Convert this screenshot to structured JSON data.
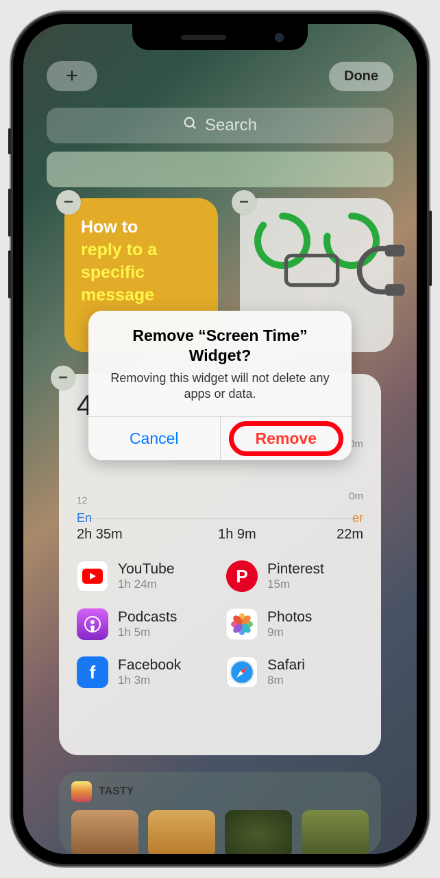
{
  "topbar": {
    "add": "+",
    "done": "Done"
  },
  "search": {
    "placeholder": "Search"
  },
  "widgets": {
    "notes": {
      "prefix": "How to",
      "highlight": "reply to a specific message"
    },
    "batteries": {
      "items": [
        {
          "icon": "phone",
          "pct": 86
        },
        {
          "icon": "headphones",
          "pct": 78
        }
      ]
    },
    "screen_time": {
      "total_visible": "4",
      "axis_labels": [
        "12"
      ],
      "right_ticks": [
        "0m",
        "0m"
      ],
      "categories": [
        {
          "label": "En",
          "time": "2h 35m"
        },
        {
          "label": "",
          "time": "1h 9m"
        },
        {
          "label": "er",
          "time": "22m"
        }
      ],
      "apps": [
        {
          "name": "YouTube",
          "time": "1h 24m",
          "icon": "youtube"
        },
        {
          "name": "Pinterest",
          "time": "15m",
          "icon": "pinterest"
        },
        {
          "name": "Podcasts",
          "time": "1h 5m",
          "icon": "podcasts"
        },
        {
          "name": "Photos",
          "time": "9m",
          "icon": "photos"
        },
        {
          "name": "Facebook",
          "time": "1h 3m",
          "icon": "facebook"
        },
        {
          "name": "Safari",
          "time": "8m",
          "icon": "safari"
        }
      ]
    },
    "tasty": {
      "title": "TASTY"
    }
  },
  "alert": {
    "title": "Remove “Screen Time” Widget?",
    "message": "Removing this widget will not delete any apps or data.",
    "cancel": "Cancel",
    "remove": "Remove"
  }
}
